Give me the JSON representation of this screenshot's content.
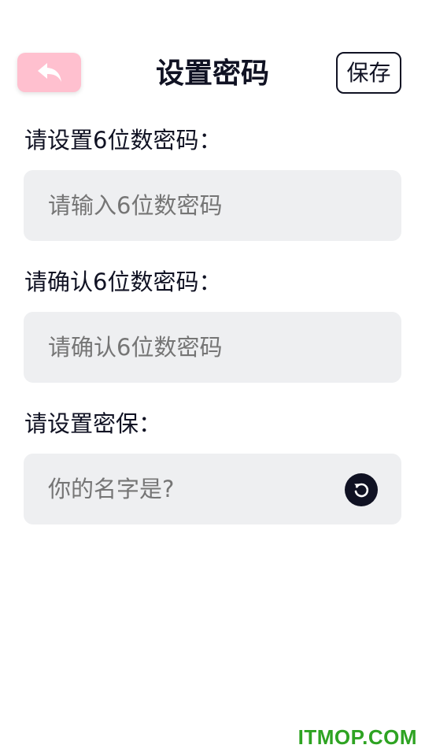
{
  "header": {
    "back_icon": "reply-arrow-icon",
    "title": "设置密码",
    "save_label": "保存",
    "back_button_color": "#ffc0cf"
  },
  "form": {
    "password": {
      "label": "请设置6位数密码：",
      "placeholder": "请输入6位数密码"
    },
    "confirm": {
      "label": "请确认6位数密码：",
      "placeholder": "请确认6位数密码"
    },
    "security": {
      "label": "请设置密保：",
      "placeholder": "你的名字是?",
      "refresh_icon": "refresh-icon"
    }
  },
  "watermark": "ITMOP.COM",
  "colors": {
    "text_primary": "#101223",
    "field_background": "#eeeff1",
    "placeholder": "#b3b4b8",
    "watermark": "#2ea322"
  }
}
